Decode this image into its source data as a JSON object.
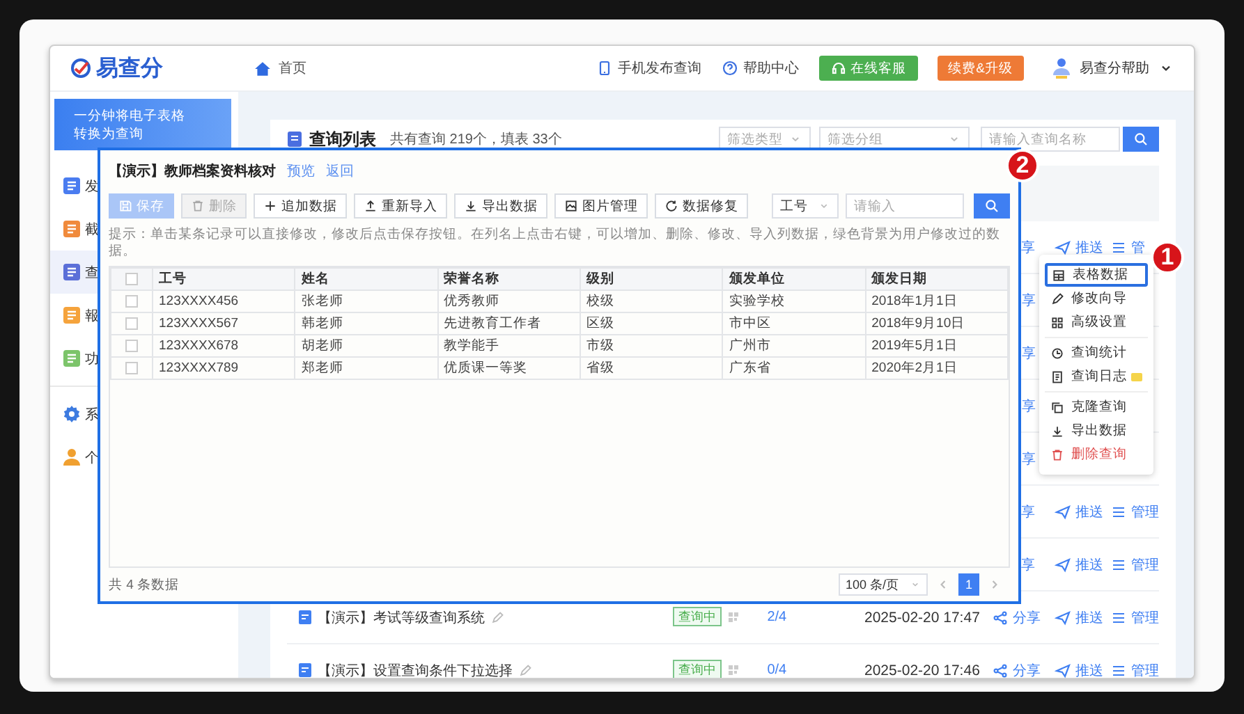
{
  "header": {
    "logo": "易查分",
    "home": "首页",
    "links": [
      {
        "label": "手机发布查询",
        "kind": "phone"
      },
      {
        "label": "帮助中心",
        "kind": "help"
      }
    ],
    "service_button": "在线客服",
    "upgrade_button": "续费&升级",
    "user": "易查分帮助"
  },
  "sidebar": {
    "banner": {
      "line_1": "一分钟将电子表格",
      "line_2": "转换为查询"
    },
    "items": [
      {
        "label": "发",
        "kind": "document",
        "color": "#4a7cf0",
        "selected": false
      },
      {
        "label": "截",
        "kind": "document",
        "color": "#f08a3c",
        "selected": false
      },
      {
        "label": "查",
        "kind": "document",
        "color": "#5b6fd8",
        "selected": true
      },
      {
        "label": "報",
        "kind": "document",
        "color": "#f5a33c",
        "selected": false
      },
      {
        "label": "功",
        "kind": "document",
        "color": "#7cc46a",
        "selected": false
      },
      {
        "label": "系",
        "kind": "gear",
        "color": "#3d7be0",
        "selected": false
      },
      {
        "label": "个",
        "kind": "person",
        "color": "#f0a030",
        "selected": false
      }
    ]
  },
  "query_list": {
    "title": "查询列表",
    "summary": "共有查询 219个，填表 33个",
    "filter_type": {
      "placeholder": "筛选类型"
    },
    "filter_group": {
      "placeholder": "筛选分组"
    },
    "search": {
      "placeholder": "请输入查询名称"
    },
    "rows": [
      {
        "kind": "covered",
        "share": "享",
        "push": "推送",
        "manage": "管"
      },
      {
        "kind": "covered",
        "share": "享"
      },
      {
        "kind": "covered",
        "share": "享"
      },
      {
        "kind": "covered",
        "share": "享"
      },
      {
        "kind": "covered",
        "share": "享"
      },
      {
        "kind": "covered",
        "share": "享",
        "push": "推送",
        "manage": "管理"
      },
      {
        "kind": "covered",
        "share": "享",
        "push": "推送",
        "manage": "管理"
      },
      {
        "kind": "full",
        "title": "【演示】考试等级查询系统",
        "status": "查询中",
        "count": "2/4",
        "time": "2025-02-20 17:47",
        "share": "分享",
        "push": "推送",
        "manage": "管理"
      },
      {
        "kind": "full",
        "title": "【演示】设置查询条件下拉选择",
        "status": "查询中",
        "count": "0/4",
        "time": "2025-02-20 17:46",
        "share": "分享",
        "push": "推送",
        "manage": "管理"
      }
    ]
  },
  "modal": {
    "title": "【演示】教师档案资料核对",
    "links": [
      "预览",
      "返回"
    ],
    "toolbar": [
      {
        "label": "保存",
        "kind": "save",
        "primary": true,
        "disabled": true
      },
      {
        "label": "删除",
        "kind": "trash",
        "primary": false,
        "disabled": true
      },
      {
        "label": "追加数据",
        "kind": "plus",
        "primary": false,
        "disabled": false
      },
      {
        "label": "重新导入",
        "kind": "upload",
        "primary": false,
        "disabled": false
      },
      {
        "label": "导出数据",
        "kind": "download",
        "primary": false,
        "disabled": false
      },
      {
        "label": "图片管理",
        "kind": "image",
        "primary": false,
        "disabled": false
      },
      {
        "label": "数据修复",
        "kind": "refresh",
        "primary": false,
        "disabled": false
      }
    ],
    "field_select": "工号",
    "search": {
      "placeholder": "请输入"
    },
    "tip": "提示：单击某条记录可以直接修改，修改后点击保存按钮。在列名上点击右键，可以增加、删除、修改、导入列数据，绿色背景为用户修改过的数据。",
    "header_checked": false,
    "columns": [
      "工号",
      "姓名",
      "荣誉名称",
      "级别",
      "颁发单位",
      "颁发日期"
    ],
    "rows": [
      {
        "checked": false,
        "cells": [
          "123XXXX456",
          "张老师",
          "优秀教师",
          "校级",
          "实验学校",
          "2018年1月1日"
        ]
      },
      {
        "checked": false,
        "cells": [
          "123XXXX567",
          "韩老师",
          "先进教育工作者",
          "区级",
          "市中区",
          "2018年9月10日"
        ]
      },
      {
        "checked": false,
        "cells": [
          "123XXXX678",
          "胡老师",
          "教学能手",
          "市级",
          "广州市",
          "2019年5月1日"
        ]
      },
      {
        "checked": false,
        "cells": [
          "123XXXX789",
          "郑老师",
          "优质课一等奖",
          "省级",
          "广东省",
          "2020年2月1日"
        ]
      }
    ],
    "total": "共 4 条数据",
    "page_size": "100 条/页",
    "pages": [
      {
        "label": "1",
        "selected": true
      }
    ]
  },
  "menu": {
    "groups": [
      [
        {
          "label": "表格数据",
          "kind": "table",
          "selected": true,
          "danger": false
        },
        {
          "label": "修改向导",
          "kind": "pencil",
          "selected": false,
          "danger": false
        },
        {
          "label": "高级设置",
          "kind": "grid",
          "selected": false,
          "danger": false
        }
      ],
      [
        {
          "label": "查询统计",
          "kind": "clock",
          "selected": false,
          "danger": false
        },
        {
          "label": "查询日志",
          "kind": "log",
          "selected": false,
          "danger": false,
          "tag": true
        }
      ],
      [
        {
          "label": "克隆查询",
          "kind": "copy",
          "selected": false,
          "danger": false
        },
        {
          "label": "导出数据",
          "kind": "download",
          "selected": false,
          "danger": false
        },
        {
          "label": "删除查询",
          "kind": "trash",
          "selected": false,
          "danger": true
        }
      ]
    ]
  },
  "callouts": [
    "1",
    "2"
  ]
}
